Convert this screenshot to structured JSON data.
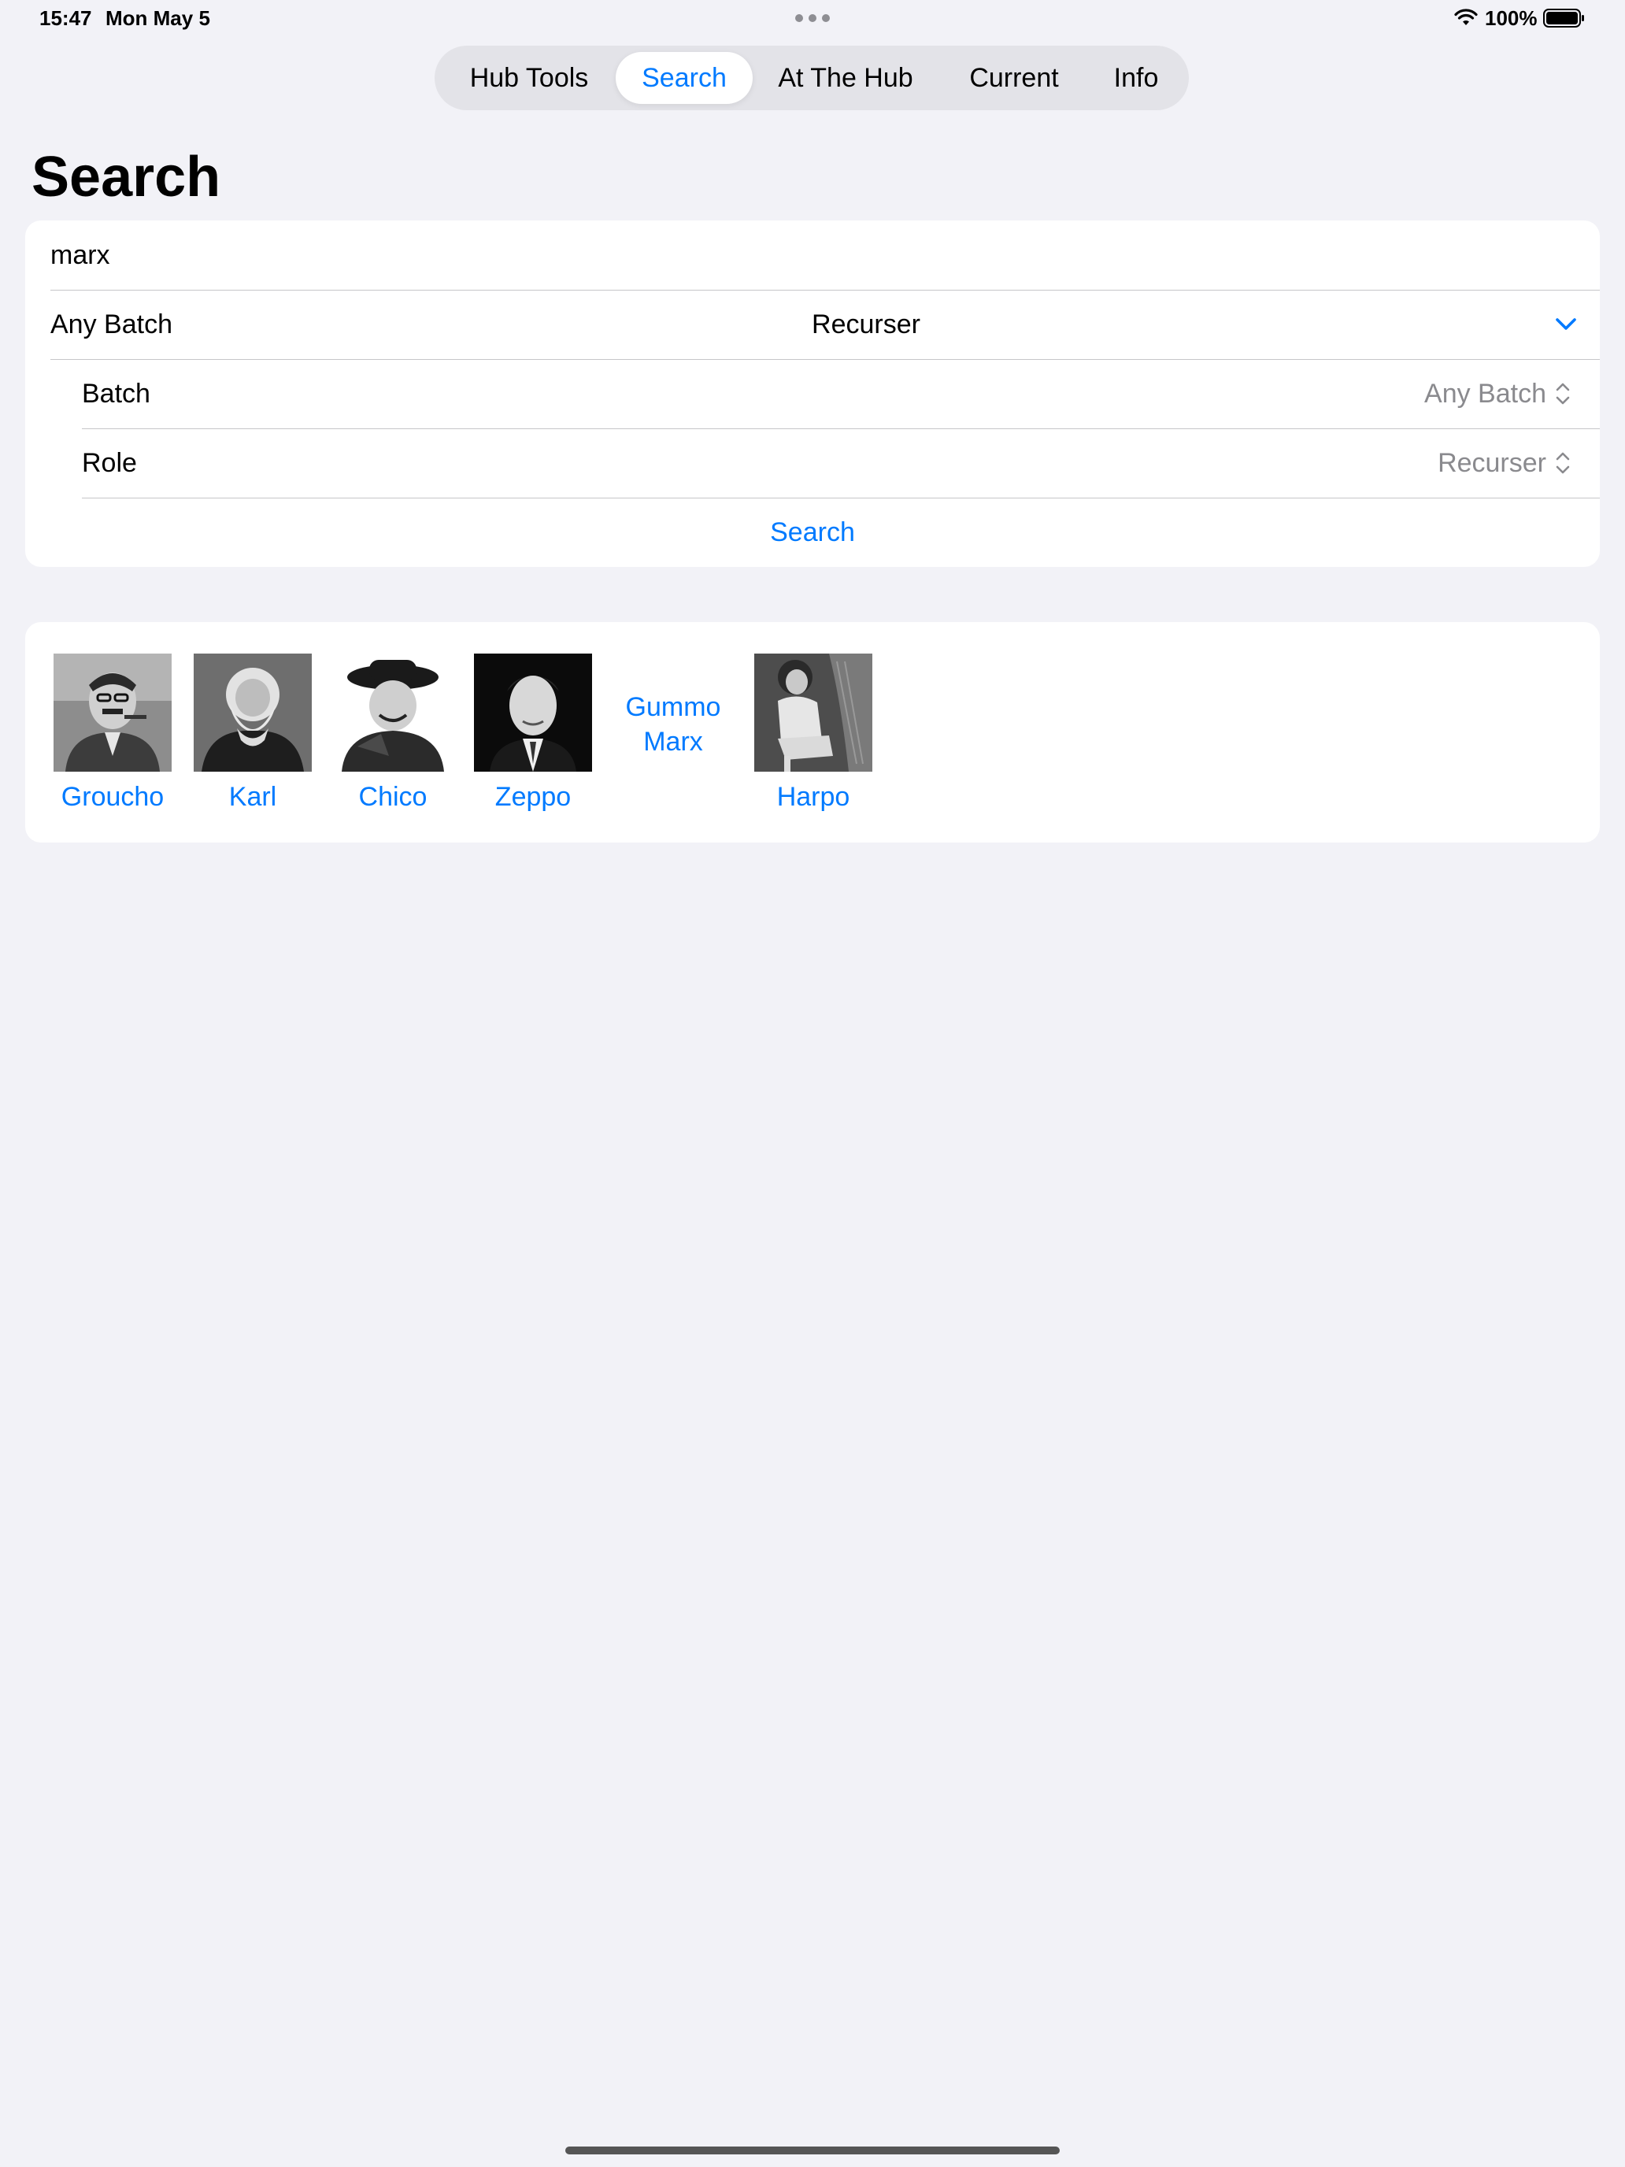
{
  "status_bar": {
    "time": "15:47",
    "date": "Mon May 5",
    "battery": "100%"
  },
  "tabs": [
    {
      "label": "Hub Tools",
      "selected": false
    },
    {
      "label": "Search",
      "selected": true
    },
    {
      "label": "At The Hub",
      "selected": false
    },
    {
      "label": "Current",
      "selected": false
    },
    {
      "label": "Info",
      "selected": false
    }
  ],
  "page_title": "Search",
  "form": {
    "query": "marx",
    "summary": {
      "batch": "Any Batch",
      "role": "Recurser"
    },
    "batch_label": "Batch",
    "batch_value": "Any Batch",
    "role_label": "Role",
    "role_value": "Recurser",
    "search_button": "Search"
  },
  "results": [
    {
      "name": "Groucho",
      "has_photo": true
    },
    {
      "name": "Karl",
      "has_photo": true
    },
    {
      "name": "Chico",
      "has_photo": true
    },
    {
      "name": "Zeppo",
      "has_photo": true
    },
    {
      "name": "Gummo Marx",
      "has_photo": false
    },
    {
      "name": "Harpo",
      "has_photo": true
    }
  ],
  "colors": {
    "accent": "#007aff",
    "background": "#f2f2f7",
    "card": "#ffffff",
    "secondary_text": "#8a8a8e"
  }
}
